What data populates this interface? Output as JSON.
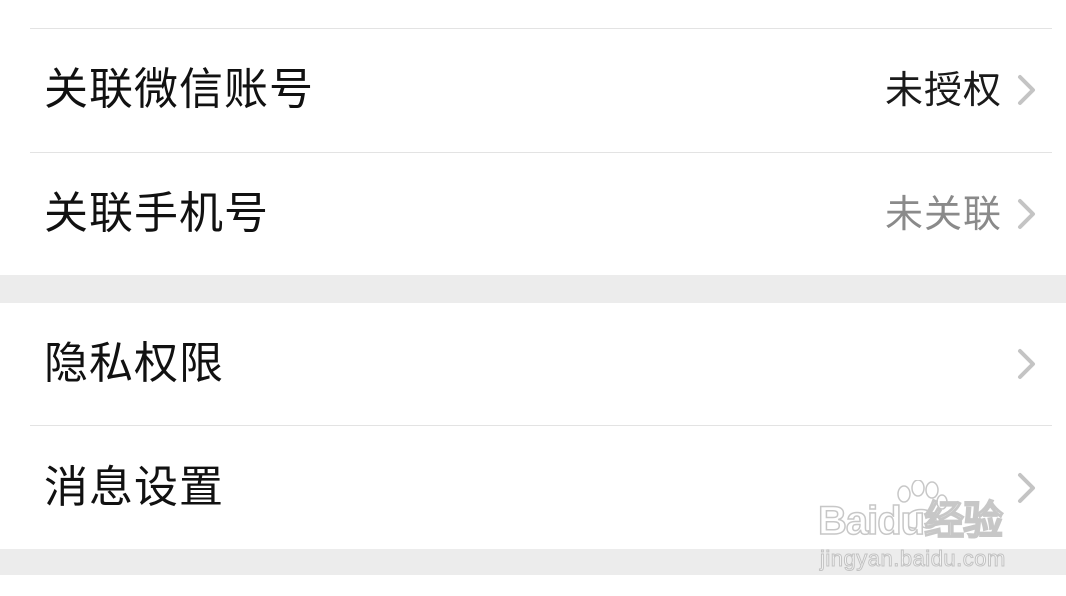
{
  "settings": {
    "rows": [
      {
        "label": "关联微信账号",
        "value": "未授权",
        "chevron_icon": "chevron-right-icon"
      },
      {
        "label": "关联手机号",
        "value": "未关联",
        "chevron_icon": "chevron-right-icon"
      },
      {
        "label": "隐私权限",
        "value": "",
        "chevron_icon": "chevron-right-icon"
      },
      {
        "label": "消息设置",
        "value": "",
        "chevron_icon": "chevron-right-icon"
      }
    ]
  },
  "watermark": {
    "brand": "Baidu经验",
    "url": "jingyan.baidu.com"
  },
  "colors": {
    "background": "#ffffff",
    "section_gap": "#ececec",
    "divider": "#e3e3e3",
    "label": "#111111",
    "value_dark": "#1a1a1a",
    "value_gray": "#8a8a8a",
    "chevron": "#c4c4c4"
  }
}
